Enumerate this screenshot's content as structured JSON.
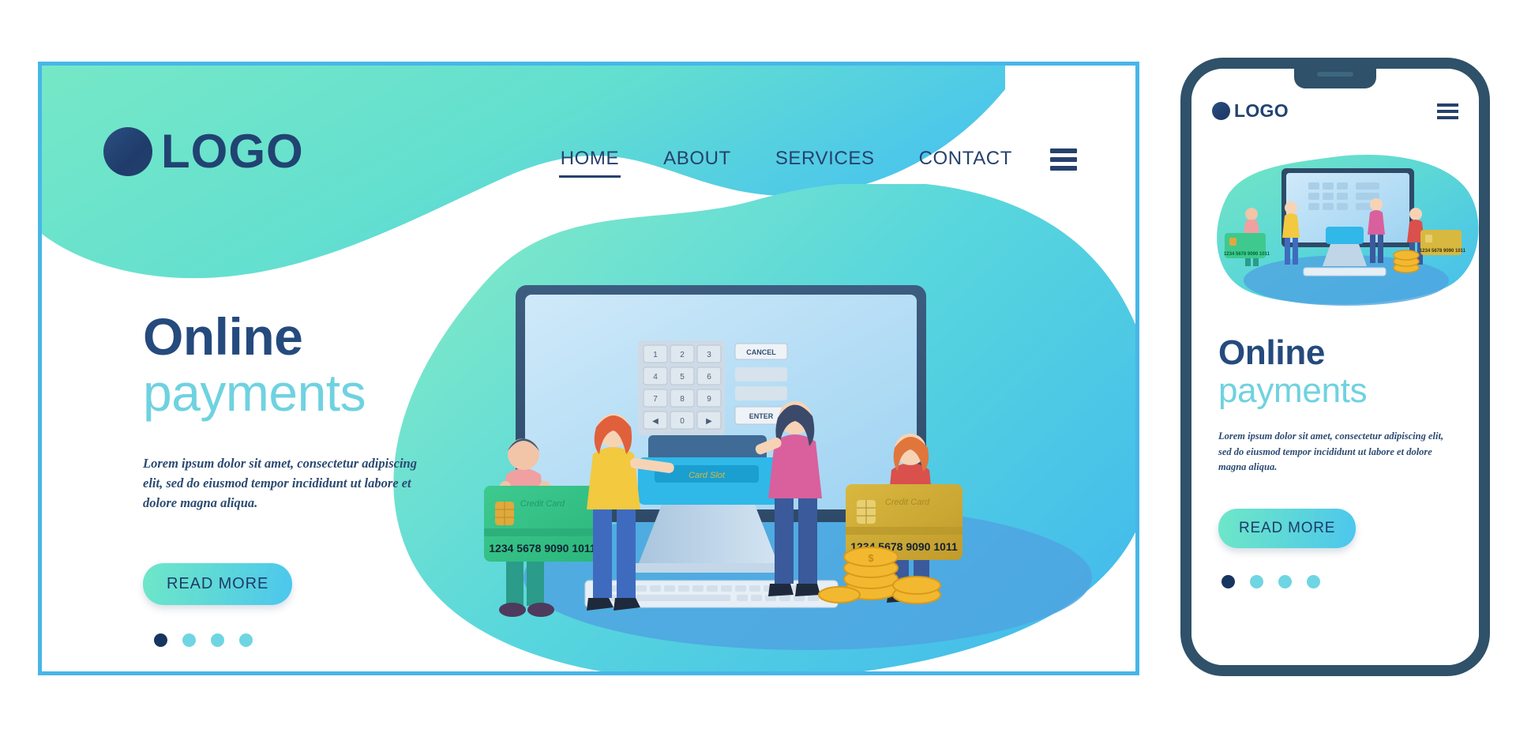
{
  "page": {
    "title": "Online payments landing page template"
  },
  "desktop": {
    "logo": {
      "text": "LOGO",
      "dot_icon": "circle-logo-icon"
    },
    "nav": {
      "items": [
        {
          "label": "HOME",
          "active": true
        },
        {
          "label": "ABOUT",
          "active": false
        },
        {
          "label": "SERVICES",
          "active": false
        },
        {
          "label": "CONTACT",
          "active": false
        }
      ],
      "menu_icon": "hamburger-menu-icon"
    },
    "hero": {
      "headline_primary": "Online",
      "headline_secondary": "payments",
      "body": "Lorem ipsum dolor sit amet, consectetur adipiscing elit, sed do eiusmod tempor incididunt ut labore et dolore magna aliqua.",
      "cta_label": "READ MORE",
      "carousel_dots": 4,
      "carousel_active_index": 0
    },
    "illustration": {
      "card_green": {
        "label": "Credit Card",
        "number": "1234  5678  9090  1011"
      },
      "card_gold": {
        "label": "Credit Card",
        "number": "1234  5678  9090  1011"
      },
      "keypad_keys": [
        "1",
        "2",
        "3",
        "4",
        "5",
        "6",
        "7",
        "8",
        "9",
        "◀",
        "0",
        "▶"
      ],
      "cancel_label": "CANCEL",
      "enter_label": "ENTER",
      "terminal_label": "Card Slot"
    }
  },
  "phone": {
    "logo": {
      "text": "LOGO",
      "dot_icon": "circle-logo-icon"
    },
    "menu_icon": "hamburger-menu-icon",
    "hero": {
      "headline_primary": "Online",
      "headline_secondary": "payments",
      "body": "Lorem ipsum dolor sit amet, consectetur adipiscing elit, sed do eiusmod tempor incididunt ut labore et dolore magna aliqua.",
      "cta_label": "READ MORE",
      "carousel_dots": 4,
      "carousel_active_index": 0
    }
  },
  "colors": {
    "frame_border": "#47b6e8",
    "phone_body": "#2f5169",
    "teal": "#6fe0c0",
    "cyan": "#4cc6ee",
    "navy": "#254a7d",
    "headline_secondary": "#6fd2e0",
    "dot_active": "#16365f",
    "dot_inactive": "#6fd5e2"
  }
}
